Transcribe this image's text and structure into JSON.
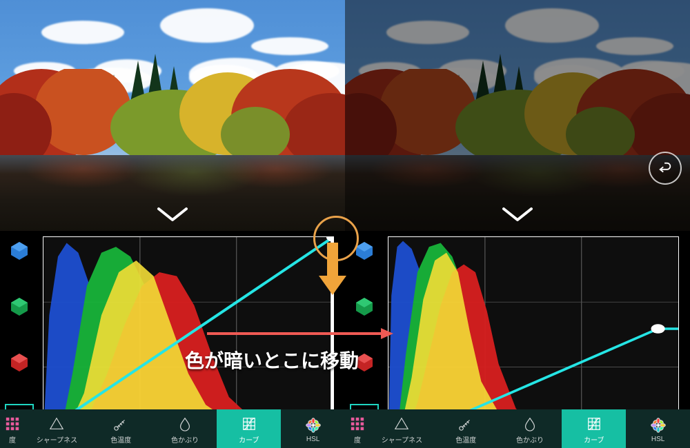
{
  "channels": {
    "blue": "blue-channel",
    "green": "green-channel",
    "red": "red-channel",
    "rgb": "rgb-channel"
  },
  "tools": [
    {
      "id": "exposure",
      "label": "度",
      "icon": "grid9"
    },
    {
      "id": "sharpness",
      "label": "シャープネス",
      "icon": "triangle"
    },
    {
      "id": "temperature",
      "label": "色温度",
      "icon": "thermometer"
    },
    {
      "id": "tint",
      "label": "色かぶり",
      "icon": "drop"
    },
    {
      "id": "curves",
      "label": "カーブ",
      "icon": "curves",
      "active": true
    },
    {
      "id": "hsl",
      "label": "HSL",
      "icon": "flower"
    }
  ],
  "annotation": {
    "text": "色が暗いとこに移動"
  },
  "left_curve": {
    "points": [
      [
        0,
        1
      ],
      [
        1,
        0
      ]
    ],
    "handleTopRight": true
  },
  "right_curve": {
    "points": [
      [
        0.11,
        1
      ],
      [
        0.93,
        0.47
      ]
    ],
    "lowHandle": [
      0.11,
      1
    ]
  }
}
